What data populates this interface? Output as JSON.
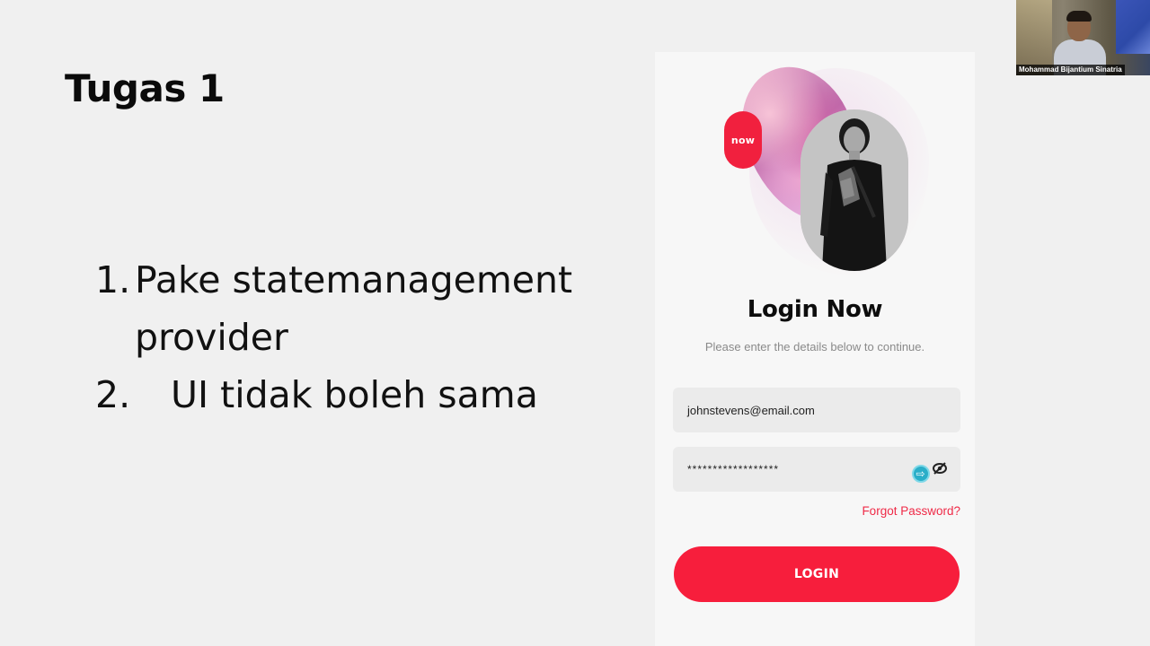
{
  "slide": {
    "title": "Tugas 1",
    "tasks": [
      {
        "num": "1.",
        "text": "Pake  statemanagement provider"
      },
      {
        "num": "2.",
        "text": "UI tidak boleh sama"
      }
    ]
  },
  "login_mock": {
    "badge": "now",
    "title": "Login Now",
    "subtitle": "Please enter the details below to continue.",
    "email_value": "johnstevens@email.com",
    "password_value": "******************",
    "forgot_label": "Forgot Password?",
    "login_label": "LOGIN",
    "accent_color": "#f71e3c",
    "icons": [
      "arrow-circle-icon",
      "eye-off-icon"
    ]
  },
  "webcam": {
    "participant_name": "Mohammad Bijantium Sinatria"
  }
}
